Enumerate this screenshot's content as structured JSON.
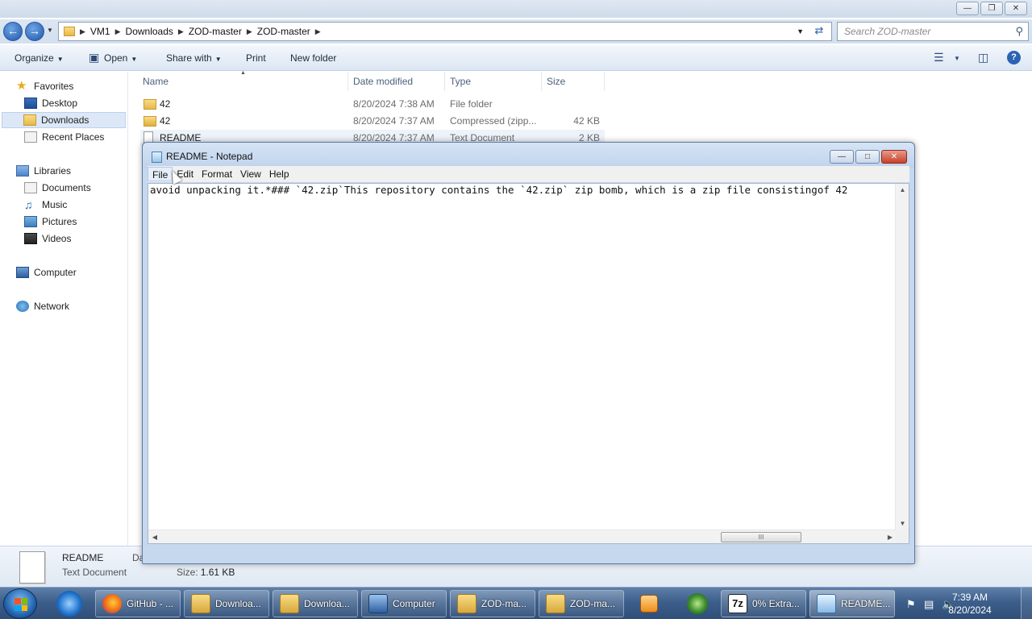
{
  "explorer": {
    "breadcrumbs": [
      "VM1",
      "Downloads",
      "ZOD-master",
      "ZOD-master"
    ],
    "search_placeholder": "Search ZOD-master",
    "toolbar": {
      "organize": "Organize",
      "open": "Open",
      "share_with": "Share with",
      "print": "Print",
      "new_folder": "New folder"
    },
    "nav": {
      "favorites": "Favorites",
      "desktop": "Desktop",
      "downloads": "Downloads",
      "recent_places": "Recent Places",
      "libraries": "Libraries",
      "documents": "Documents",
      "music": "Music",
      "pictures": "Pictures",
      "videos": "Videos",
      "computer": "Computer",
      "network": "Network"
    },
    "columns": {
      "name": "Name",
      "date_modified": "Date modified",
      "type": "Type",
      "size": "Size"
    },
    "files": [
      {
        "name": "42",
        "date": "8/20/2024 7:38 AM",
        "type": "File folder",
        "size": ""
      },
      {
        "name": "42",
        "date": "8/20/2024 7:37 AM",
        "type": "Compressed (zipp...",
        "size": "42 KB"
      },
      {
        "name": "README",
        "date": "8/20/2024 7:37 AM",
        "type": "Text Document",
        "size": "2 KB"
      }
    ],
    "details": {
      "name": "README",
      "type": "Text Document",
      "cut_label": "Da",
      "size_label": "Size:",
      "size_value": "1.61 KB"
    }
  },
  "notepad": {
    "title": "README - Notepad",
    "menu": {
      "file": "File",
      "edit": "Edit",
      "format": "Format",
      "view": "View",
      "help": "Help"
    },
    "content": "avoid unpacking it.*### `42.zip`This repository contains the `42.zip` zip bomb, which is a zip file consistingof 42",
    "hthumb_grip": "III"
  },
  "taskbar": {
    "tasks": {
      "github": "GitHub - ...",
      "downloads1": "Downloa...",
      "downloads2": "Downloa...",
      "computer": "Computer",
      "zod1": "ZOD-ma...",
      "zod2": "ZOD-ma...",
      "extract": "0% Extra...",
      "readme": "README..."
    },
    "sevenzip_label": "7z",
    "time": "7:39 AM",
    "date": "8/20/2024"
  },
  "colors": {
    "accent": "#2b63b5",
    "taskbar": "#3d5f8b",
    "selection": "#dce8f7"
  }
}
